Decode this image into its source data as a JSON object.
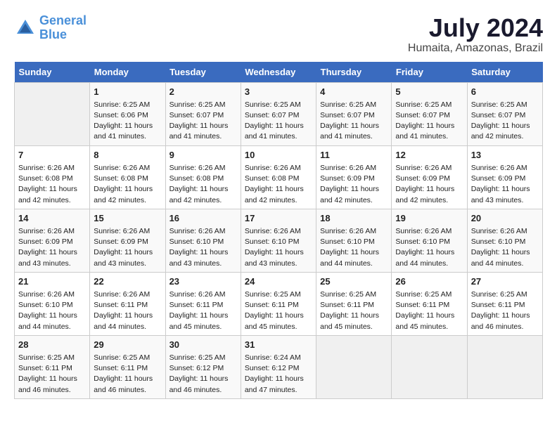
{
  "header": {
    "logo_line1": "General",
    "logo_line2": "Blue",
    "month": "July 2024",
    "location": "Humaita, Amazonas, Brazil"
  },
  "weekdays": [
    "Sunday",
    "Monday",
    "Tuesday",
    "Wednesday",
    "Thursday",
    "Friday",
    "Saturday"
  ],
  "weeks": [
    [
      {
        "day": "",
        "info": ""
      },
      {
        "day": "1",
        "info": "Sunrise: 6:25 AM\nSunset: 6:06 PM\nDaylight: 11 hours\nand 41 minutes."
      },
      {
        "day": "2",
        "info": "Sunrise: 6:25 AM\nSunset: 6:07 PM\nDaylight: 11 hours\nand 41 minutes."
      },
      {
        "day": "3",
        "info": "Sunrise: 6:25 AM\nSunset: 6:07 PM\nDaylight: 11 hours\nand 41 minutes."
      },
      {
        "day": "4",
        "info": "Sunrise: 6:25 AM\nSunset: 6:07 PM\nDaylight: 11 hours\nand 41 minutes."
      },
      {
        "day": "5",
        "info": "Sunrise: 6:25 AM\nSunset: 6:07 PM\nDaylight: 11 hours\nand 41 minutes."
      },
      {
        "day": "6",
        "info": "Sunrise: 6:25 AM\nSunset: 6:07 PM\nDaylight: 11 hours\nand 42 minutes."
      }
    ],
    [
      {
        "day": "7",
        "info": "Sunrise: 6:26 AM\nSunset: 6:08 PM\nDaylight: 11 hours\nand 42 minutes."
      },
      {
        "day": "8",
        "info": "Sunrise: 6:26 AM\nSunset: 6:08 PM\nDaylight: 11 hours\nand 42 minutes."
      },
      {
        "day": "9",
        "info": "Sunrise: 6:26 AM\nSunset: 6:08 PM\nDaylight: 11 hours\nand 42 minutes."
      },
      {
        "day": "10",
        "info": "Sunrise: 6:26 AM\nSunset: 6:08 PM\nDaylight: 11 hours\nand 42 minutes."
      },
      {
        "day": "11",
        "info": "Sunrise: 6:26 AM\nSunset: 6:09 PM\nDaylight: 11 hours\nand 42 minutes."
      },
      {
        "day": "12",
        "info": "Sunrise: 6:26 AM\nSunset: 6:09 PM\nDaylight: 11 hours\nand 42 minutes."
      },
      {
        "day": "13",
        "info": "Sunrise: 6:26 AM\nSunset: 6:09 PM\nDaylight: 11 hours\nand 43 minutes."
      }
    ],
    [
      {
        "day": "14",
        "info": "Sunrise: 6:26 AM\nSunset: 6:09 PM\nDaylight: 11 hours\nand 43 minutes."
      },
      {
        "day": "15",
        "info": "Sunrise: 6:26 AM\nSunset: 6:09 PM\nDaylight: 11 hours\nand 43 minutes."
      },
      {
        "day": "16",
        "info": "Sunrise: 6:26 AM\nSunset: 6:10 PM\nDaylight: 11 hours\nand 43 minutes."
      },
      {
        "day": "17",
        "info": "Sunrise: 6:26 AM\nSunset: 6:10 PM\nDaylight: 11 hours\nand 43 minutes."
      },
      {
        "day": "18",
        "info": "Sunrise: 6:26 AM\nSunset: 6:10 PM\nDaylight: 11 hours\nand 44 minutes."
      },
      {
        "day": "19",
        "info": "Sunrise: 6:26 AM\nSunset: 6:10 PM\nDaylight: 11 hours\nand 44 minutes."
      },
      {
        "day": "20",
        "info": "Sunrise: 6:26 AM\nSunset: 6:10 PM\nDaylight: 11 hours\nand 44 minutes."
      }
    ],
    [
      {
        "day": "21",
        "info": "Sunrise: 6:26 AM\nSunset: 6:10 PM\nDaylight: 11 hours\nand 44 minutes."
      },
      {
        "day": "22",
        "info": "Sunrise: 6:26 AM\nSunset: 6:11 PM\nDaylight: 11 hours\nand 44 minutes."
      },
      {
        "day": "23",
        "info": "Sunrise: 6:26 AM\nSunset: 6:11 PM\nDaylight: 11 hours\nand 45 minutes."
      },
      {
        "day": "24",
        "info": "Sunrise: 6:25 AM\nSunset: 6:11 PM\nDaylight: 11 hours\nand 45 minutes."
      },
      {
        "day": "25",
        "info": "Sunrise: 6:25 AM\nSunset: 6:11 PM\nDaylight: 11 hours\nand 45 minutes."
      },
      {
        "day": "26",
        "info": "Sunrise: 6:25 AM\nSunset: 6:11 PM\nDaylight: 11 hours\nand 45 minutes."
      },
      {
        "day": "27",
        "info": "Sunrise: 6:25 AM\nSunset: 6:11 PM\nDaylight: 11 hours\nand 46 minutes."
      }
    ],
    [
      {
        "day": "28",
        "info": "Sunrise: 6:25 AM\nSunset: 6:11 PM\nDaylight: 11 hours\nand 46 minutes."
      },
      {
        "day": "29",
        "info": "Sunrise: 6:25 AM\nSunset: 6:11 PM\nDaylight: 11 hours\nand 46 minutes."
      },
      {
        "day": "30",
        "info": "Sunrise: 6:25 AM\nSunset: 6:12 PM\nDaylight: 11 hours\nand 46 minutes."
      },
      {
        "day": "31",
        "info": "Sunrise: 6:24 AM\nSunset: 6:12 PM\nDaylight: 11 hours\nand 47 minutes."
      },
      {
        "day": "",
        "info": ""
      },
      {
        "day": "",
        "info": ""
      },
      {
        "day": "",
        "info": ""
      }
    ]
  ]
}
